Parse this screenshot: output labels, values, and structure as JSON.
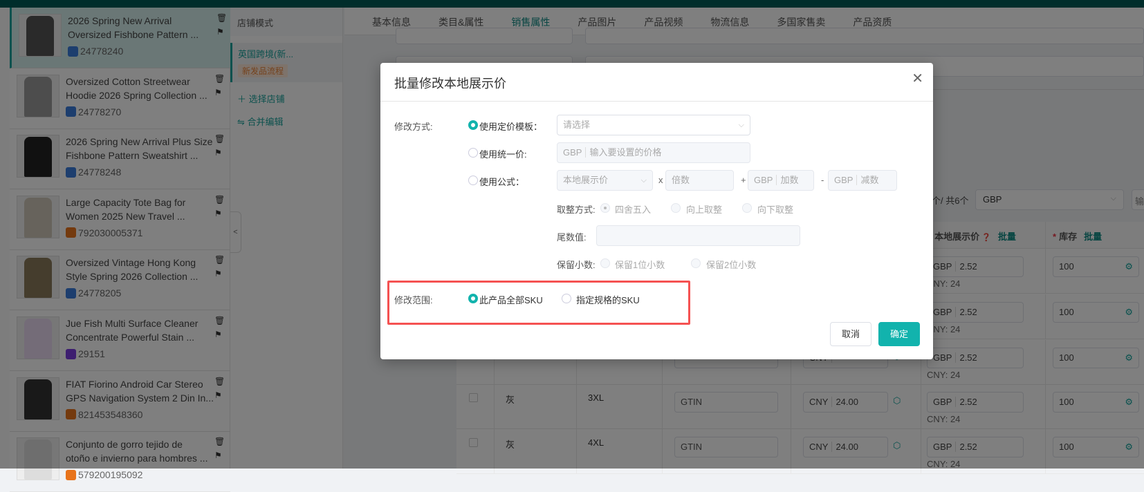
{
  "products": [
    {
      "title1": "2026 Spring New Arrival",
      "title2": "Oversized Fishbone Pattern ...",
      "id": "24778240",
      "badge": "#3b7ddd",
      "thumb": "#555"
    },
    {
      "title1": "Oversized Cotton Streetwear",
      "title2": "Hoodie 2026 Spring Collection ...",
      "id": "24778270",
      "badge": "#3b7ddd",
      "thumb": "#9a9a9a"
    },
    {
      "title1": "2026 Spring New Arrival Plus Size",
      "title2": "Fishbone Pattern Sweatshirt ...",
      "id": "24778248",
      "badge": "#3b7ddd",
      "thumb": "#222"
    },
    {
      "title1": "Large Capacity Tote Bag for",
      "title2": "Women 2025 New Travel ...",
      "id": "792030005371",
      "badge": "#e8741c",
      "thumb": "#cfc6b8"
    },
    {
      "title1": "Oversized Vintage Hong Kong",
      "title2": "Style Spring 2026 Collection ...",
      "id": "24778205",
      "badge": "#3b7ddd",
      "thumb": "#8a7a5a"
    },
    {
      "title1": "Jue Fish Multi Surface Cleaner",
      "title2": "Concentrate Powerful Stain ...",
      "id": "29151",
      "badge": "#7a3de0",
      "thumb": "#e8d8f0"
    },
    {
      "title1": "FIAT Fiorino Android Car Stereo",
      "title2": "GPS Navigation System 2 Din In...",
      "id": "821453548360",
      "badge": "#e8741c",
      "thumb": "#333"
    },
    {
      "title1": "Conjunto de gorro tejido de",
      "title2": "otoño e invierno para hombres ...",
      "id": "579200195092",
      "badge": "#e8741c",
      "thumb": "#ddd"
    }
  ],
  "store": {
    "header": "店铺模式",
    "selected": "英国跨境(新...",
    "tag": "新发品流程",
    "select_store": "选择店铺",
    "merge_edit": "合并编辑"
  },
  "tabs": [
    "基本信息",
    "类目&属性",
    "销售属性",
    "产品图片",
    "产品视频",
    "物流信息",
    "多国家售卖",
    "产品资质"
  ],
  "toolbar": {
    "count": "个/ 共6个",
    "currency": "GBP",
    "more": "输"
  },
  "table": {
    "h_local_price": "本地展示价",
    "h_stock": "库存",
    "batch": "批量",
    "rows": [
      {
        "color": "",
        "size": "",
        "gtin": "",
        "cny": "",
        "gbp": "2.52",
        "cny_note": "CNY:  24",
        "stock": "100"
      },
      {
        "color": "",
        "size": "",
        "gtin": "",
        "cny": "",
        "gbp": "2.52",
        "cny_note": "CNY:  24",
        "stock": "100"
      },
      {
        "color": "",
        "size": "",
        "gtin": "",
        "cny": "",
        "gbp": "2.52",
        "cny_note": "CNY:  24",
        "stock": "100"
      },
      {
        "color": "灰",
        "size": "3XL",
        "gtin": "GTIN",
        "cny": "24.00",
        "gbp": "2.52",
        "cny_note": "CNY:  24",
        "stock": "100"
      },
      {
        "color": "灰",
        "size": "4XL",
        "gtin": "GTIN",
        "cny": "24.00",
        "gbp": "2.52",
        "cny_note": "CNY:  24",
        "stock": "100"
      }
    ],
    "cny_prefix": "CNY",
    "gbp_prefix": "GBP"
  },
  "modal": {
    "title": "批量修改本地展示价",
    "method_label": "修改方式:",
    "opt_template": "使用定价模板：",
    "template_placeholder": "请选择",
    "opt_unified": "使用统一价:",
    "unified_prefix": "GBP",
    "unified_placeholder": "输入要设置的价格",
    "opt_formula": "使用公式：",
    "formula_base": "本地展示价",
    "times": "x",
    "multiplier_placeholder": "倍数",
    "plus": "+",
    "add_prefix": "GBP",
    "add_placeholder": "加数",
    "minus": "-",
    "sub_prefix": "GBP",
    "sub_placeholder": "减数",
    "rounding_label": "取整方式:",
    "round_half": "四舍五入",
    "round_up": "向上取整",
    "round_down": "向下取整",
    "tail_label": "尾数值:",
    "decimal_label": "保留小数:",
    "decimal_1": "保留1位小数",
    "decimal_2": "保留2位小数",
    "scope_label": "修改范围:",
    "scope_all": "此产品全部SKU",
    "scope_spec": "指定规格的SKU",
    "cancel": "取消",
    "confirm": "确定"
  }
}
